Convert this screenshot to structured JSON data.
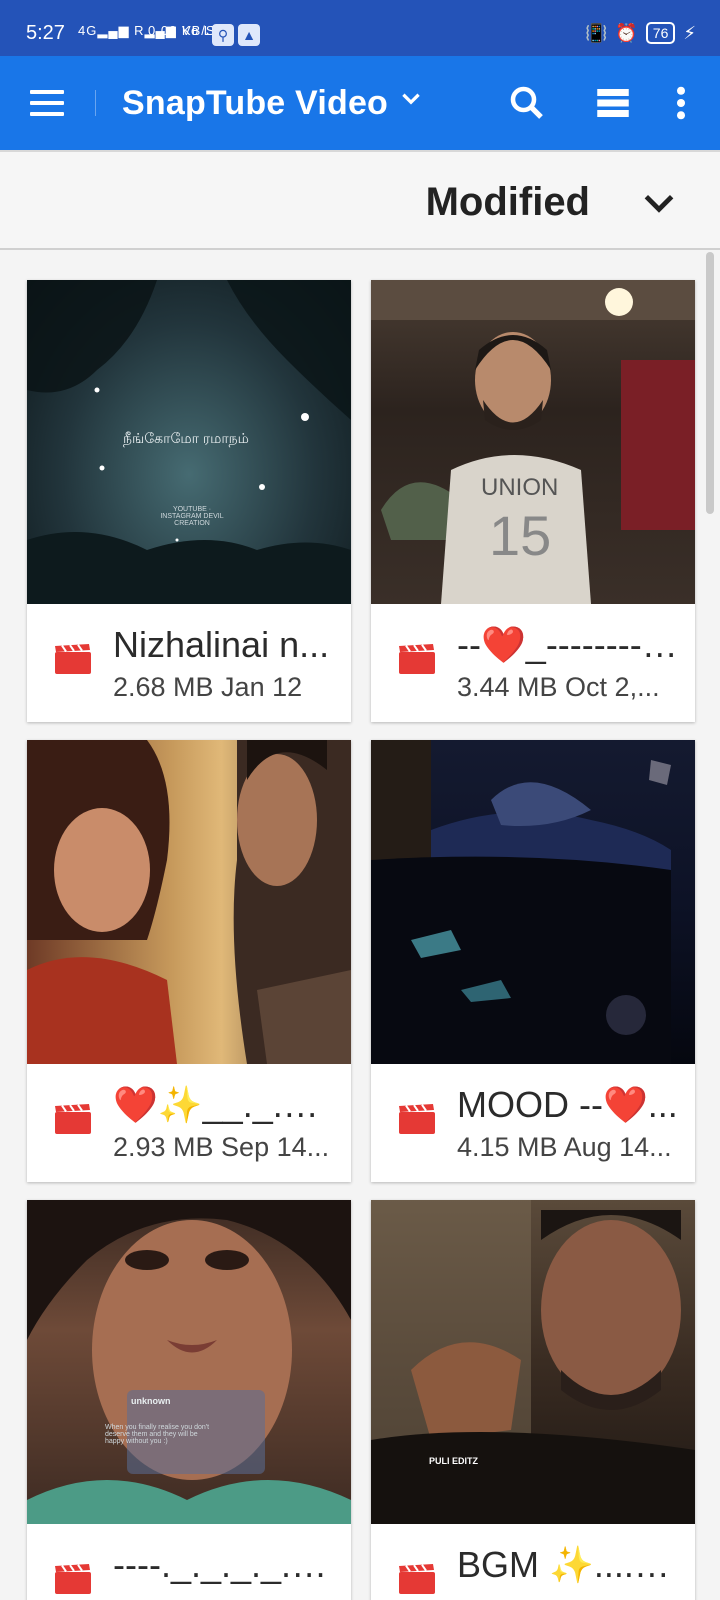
{
  "status_bar": {
    "time": "5:27",
    "network": "4G",
    "speed": "0.08 KB/S",
    "volte": "Vo LTE",
    "battery": "76"
  },
  "app_bar": {
    "title": "SnapTube Video"
  },
  "sort": {
    "label": "Modified"
  },
  "videos": [
    {
      "title": "Nizhalinai n...",
      "meta": "2.68 MB Jan 12",
      "thumb_caption": "நீங்கோமோ ரமாநம்",
      "thumb_small": "YOUTUBE · INSTAGRAM  DEVIL CREATION"
    },
    {
      "title": "--❤️_-------- --...",
      "meta": "3.44 MB Oct 2,..."
    },
    {
      "title": "❤️✨__._._._....",
      "meta": "2.93 MB Sep 14..."
    },
    {
      "title": "MOOD --❤️...",
      "meta": "4.15 MB Aug 14..."
    },
    {
      "title": "----._._._._._....",
      "meta": "",
      "thumb_caption": "unknown",
      "thumb_small": "When you finally realise you don't deserve them and they will be happy without you :)"
    },
    {
      "title": "BGM ✨...._...",
      "meta": "",
      "thumb_caption": "PULI EDITZ"
    }
  ],
  "colors": {
    "status_bar": "#2453b8",
    "app_bar": "#1976e8",
    "video_icon": "#e53935"
  }
}
